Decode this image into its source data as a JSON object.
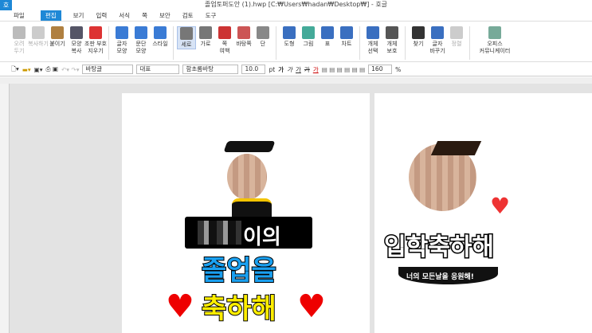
{
  "app": {
    "logo": "호",
    "title": "졸업토퍼도안 (1).hwp [C:₩Users₩hadan₩Desktop₩] - 호글"
  },
  "menu": [
    "파일",
    "편집",
    "보기",
    "입력",
    "서식",
    "쪽",
    "보안",
    "검토",
    "도구"
  ],
  "ribbon": [
    {
      "label": "오려\n두기",
      "disabled": true,
      "color": "#bbb"
    },
    {
      "label": "복사하기",
      "disabled": true,
      "color": "#ccc"
    },
    {
      "label": "붙이기",
      "color": "#b08040"
    },
    {
      "label": "모양\n복사",
      "color": "#556"
    },
    {
      "label": "조판 부호\n지우기",
      "color": "#d33"
    },
    {
      "label": "글자\n모양",
      "color": "#3a7bd5"
    },
    {
      "label": "문단\n모양",
      "color": "#3a7bd5"
    },
    {
      "label": "스타일",
      "color": "#3a7bd5"
    },
    {
      "label": "세로",
      "selected": true,
      "color": "#777"
    },
    {
      "label": "가로",
      "color": "#777"
    },
    {
      "label": "쪽\n여백",
      "color": "#c33"
    },
    {
      "label": "바탕쪽",
      "color": "#c55"
    },
    {
      "label": "단",
      "color": "#888"
    },
    {
      "label": "도형",
      "color": "#3a6fc0"
    },
    {
      "label": "그림",
      "color": "#4a9"
    },
    {
      "label": "표",
      "color": "#3a6fc0"
    },
    {
      "label": "차트",
      "color": "#3a6fc0"
    },
    {
      "label": "개체\n선택",
      "color": "#3a6fc0"
    },
    {
      "label": "개체\n보호",
      "color": "#555"
    },
    {
      "label": "찾기",
      "color": "#333"
    },
    {
      "label": "글자\n바꾸기",
      "color": "#3a6fc0"
    },
    {
      "label": "정렬",
      "disabled": true,
      "color": "#ccc"
    },
    {
      "label": "오피스\n커뮤니케이터",
      "color": "#7a9"
    }
  ],
  "format": {
    "style": "바탕글",
    "lang": "대표",
    "font": "함초롬바탕",
    "size": "10.0",
    "unit": "pt",
    "bold": "가",
    "italic": "가",
    "underline": "가",
    "strike": "가",
    "color": "가",
    "zoom": "160",
    "zoom_unit": "%"
  },
  "doc": {
    "name_suffix": "이의",
    "line2": "졸업을",
    "line3": "축하해",
    "sticker2_title": "입학축하해",
    "sticker2_banner": "너의 모든날을 응원해!"
  }
}
